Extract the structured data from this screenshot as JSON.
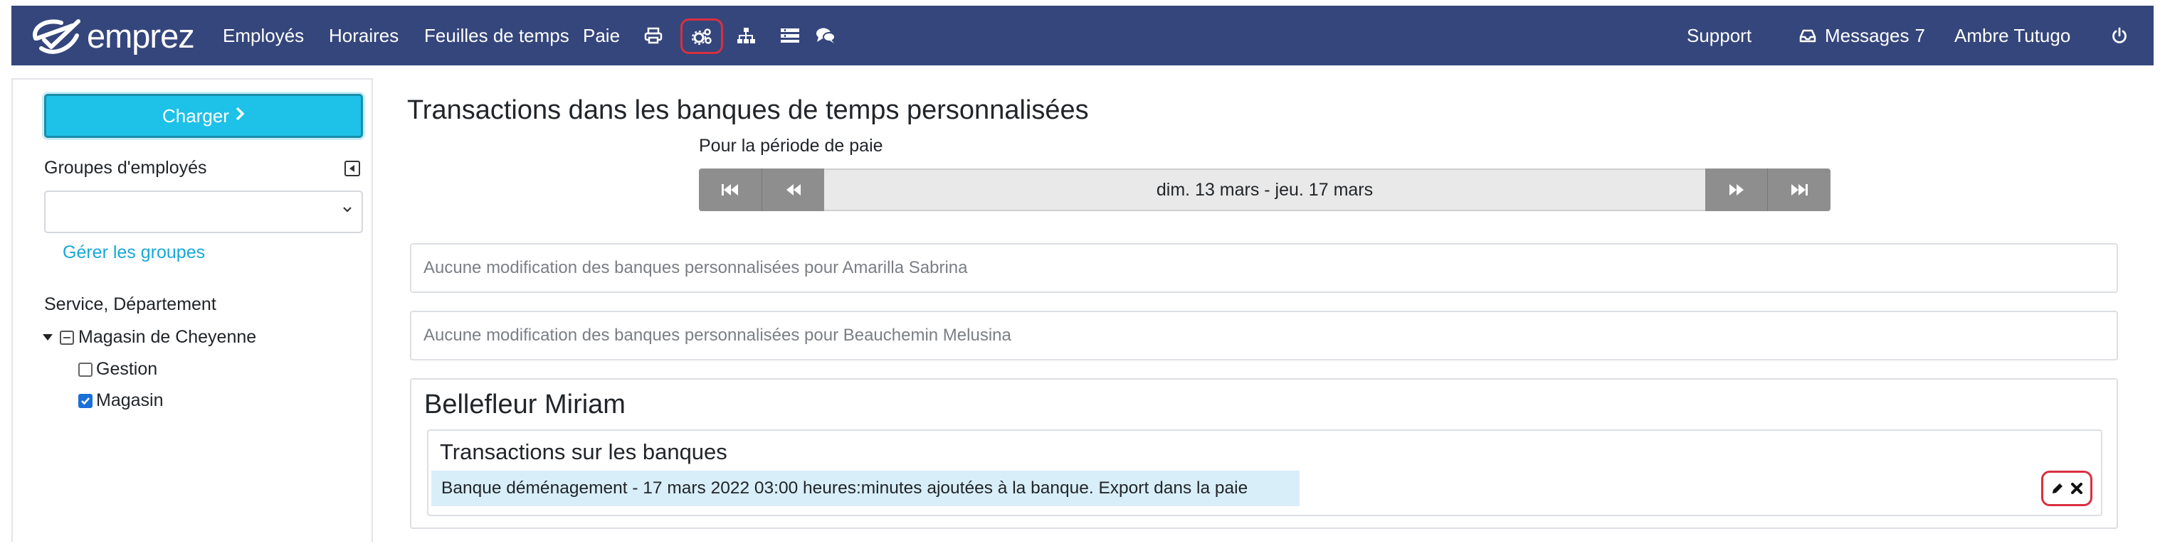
{
  "navbar": {
    "brand": "emprez",
    "links": {
      "employes": "Employés",
      "horaires": "Horaires",
      "feuilles": "Feuilles de temps",
      "paie": "Paie",
      "support": "Support",
      "messages_label": "Messages",
      "messages_count": "7",
      "user": "Ambre Tutugo"
    },
    "icons": [
      "printer-icon",
      "cogs-icon",
      "org-chart-icon",
      "list-icon",
      "comments-icon",
      "inbox-icon",
      "power-icon"
    ],
    "background_color": "#35467c",
    "highlight_color": "#d93040"
  },
  "sidebar": {
    "load_button": "Charger",
    "groups_label": "Groupes d'employés",
    "groups_select_value": "",
    "manage_groups_link": "Gérer les groupes",
    "service_label": "Service, Département",
    "tree": {
      "root": "Magasin de Cheyenne",
      "children": [
        {
          "label": "Gestion",
          "checked": false
        },
        {
          "label": "Magasin",
          "checked": true
        }
      ]
    },
    "accent_color": "#1ec1e8"
  },
  "main": {
    "title": "Transactions dans les banques de temps personnalisées",
    "period_label": "Pour la période de paie",
    "period_range": "dim. 13 mars - jeu. 17 mars",
    "notices": [
      "Aucune modification des banques personnalisées pour Amarilla Sabrina",
      "Aucune modification des banques personnalisées pour Beauchemin Melusina"
    ],
    "employee": {
      "name": "Bellefleur Miriam",
      "transactions_title": "Transactions sur les banques",
      "transaction_text": "Banque déménagement - 17 mars 2022  03:00 heures:minutes ajoutées à la banque. Export dans la paie"
    }
  }
}
